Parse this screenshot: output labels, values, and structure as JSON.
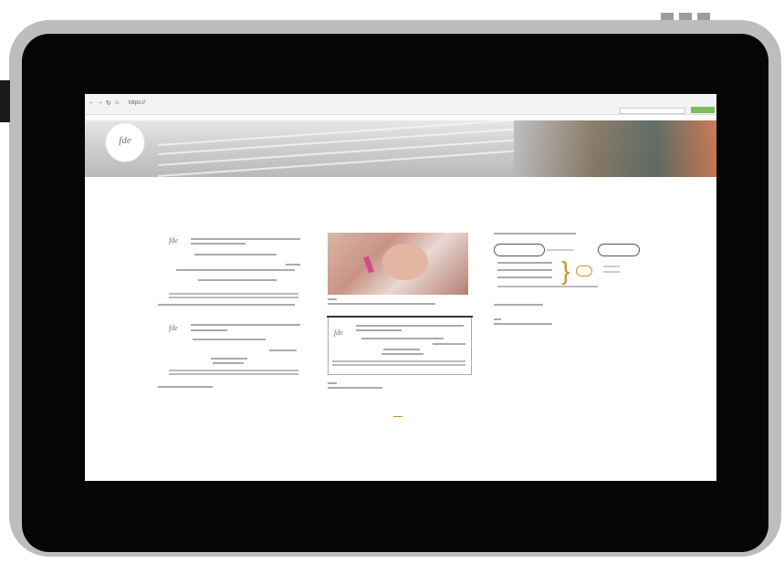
{
  "browser": {
    "url": "https://",
    "nav_icons": [
      "back-icon",
      "forward-icon",
      "reload-icon",
      "home-icon"
    ]
  },
  "page": {
    "banner_title": "",
    "nav_items": [
      "",
      "",
      "",
      ""
    ],
    "title": "",
    "intro": "",
    "pagination": ""
  },
  "colors": {
    "accent": "#c9922b",
    "search_button": "#7cbc5a",
    "logo_text": "#6a6aa0"
  }
}
